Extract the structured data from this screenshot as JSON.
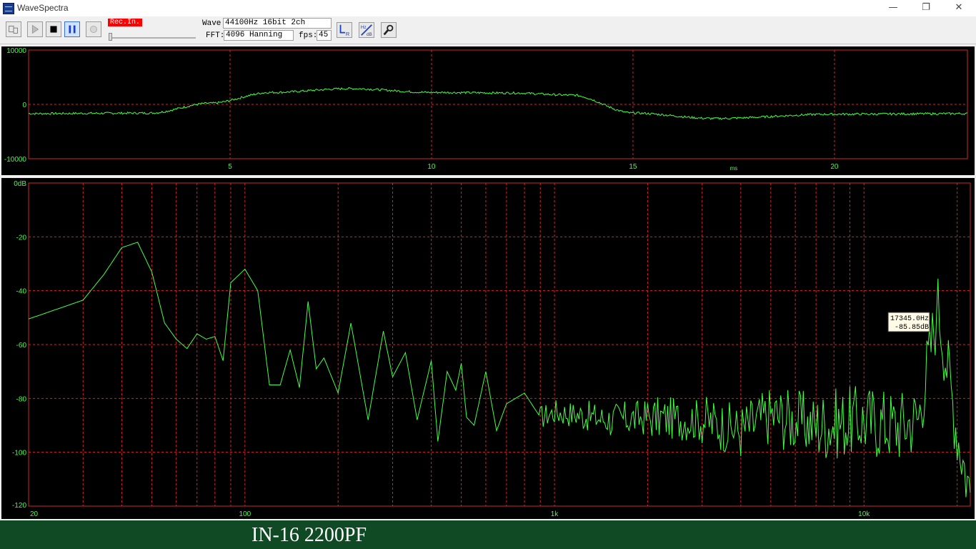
{
  "window": {
    "title": "WaveSpectra",
    "minimize": "—",
    "restore": "❐",
    "close": "✕"
  },
  "toolbar": {
    "buttons": [
      "settings-icon",
      "play-icon",
      "stop-icon",
      "pause-icon",
      "record-icon"
    ],
    "rec_badge": "Rec.In.",
    "wave_label": "Wave:",
    "wave_value": "44100Hz 16bit 2ch",
    "fft_label": "FFT:",
    "fft_value": "4096 Hanning",
    "fps_label": "fps:",
    "fps_value": "45",
    "extra_buttons": [
      "lr-channel-icon",
      "hz-db-icon",
      "wrench-icon"
    ],
    "hz_text": "Hz",
    "db_text": "dB",
    "l_text": "L",
    "r_text": "R"
  },
  "waveform": {
    "y_ticks": [
      "10000",
      "0",
      "-10000"
    ],
    "x_ticks": [
      "5",
      "10",
      "15",
      "20"
    ],
    "x_unit": "ms",
    "colors": {
      "trace": "#44ff44",
      "grid": "#cc2a2a",
      "frame": "#cc2a2a",
      "background": "#000000"
    }
  },
  "spectrum": {
    "y_ticks": [
      "0dB",
      "-20",
      "-40",
      "-60",
      "-80",
      "-100",
      "-120"
    ],
    "x_ticks": [
      "20",
      "100",
      "1k",
      "10k"
    ],
    "cursor": {
      "freq": "17345.0Hz",
      "level": "-85.85dB"
    },
    "colors": {
      "trace": "#44ff44",
      "grid": "#cc2a2a"
    }
  },
  "chart_data": [
    {
      "type": "line",
      "xlabel": "ms",
      "ylim": [
        -10000,
        10000
      ],
      "xlim": [
        0,
        23.3
      ],
      "series": [
        {
          "x": [
            0,
            3,
            4.5,
            6,
            8,
            10,
            12,
            13.5,
            15,
            17,
            20,
            23.3
          ],
          "y": [
            -1700,
            -1600,
            200,
            2200,
            2900,
            2200,
            2100,
            1700,
            -1600,
            -2600,
            -1800,
            -1700
          ]
        }
      ]
    },
    {
      "type": "line",
      "ylim": [
        -120,
        0
      ],
      "xlim": [
        20,
        22050
      ],
      "x_scale": "log",
      "series": [
        {
          "x": [
            20,
            30,
            35,
            40,
            45,
            50,
            55,
            60,
            65,
            70,
            75,
            80,
            85,
            90,
            100,
            110,
            120,
            130,
            140,
            150,
            160,
            170,
            180,
            200,
            220,
            250,
            280,
            300,
            330,
            360,
            400,
            420,
            450,
            480,
            500,
            520,
            550,
            600,
            650,
            700,
            800,
            900,
            1000,
            1200,
            1500,
            2000,
            3000,
            4000,
            5000,
            7000,
            10000,
            13000,
            15000,
            17345,
            20000,
            22050
          ],
          "y": [
            -50.5,
            -43.5,
            -34,
            -24,
            -22,
            -33,
            -52,
            -58,
            -61.5,
            -56,
            -58,
            -57,
            -66,
            -37,
            -32,
            -40,
            -75,
            -75,
            -62,
            -76,
            -44,
            -69,
            -65,
            -78,
            -52,
            -88,
            -55,
            -72,
            -63,
            -88,
            -66,
            -96,
            -70,
            -77,
            -67,
            -87,
            -90,
            -70,
            -92,
            -82,
            -78,
            -87,
            -85,
            -86,
            -88,
            -87,
            -88,
            -92,
            -86,
            -90,
            -88,
            -90,
            -87,
            -45,
            -92,
            -115
          ]
        }
      ]
    }
  ],
  "caption": "IN-16 2200PF"
}
